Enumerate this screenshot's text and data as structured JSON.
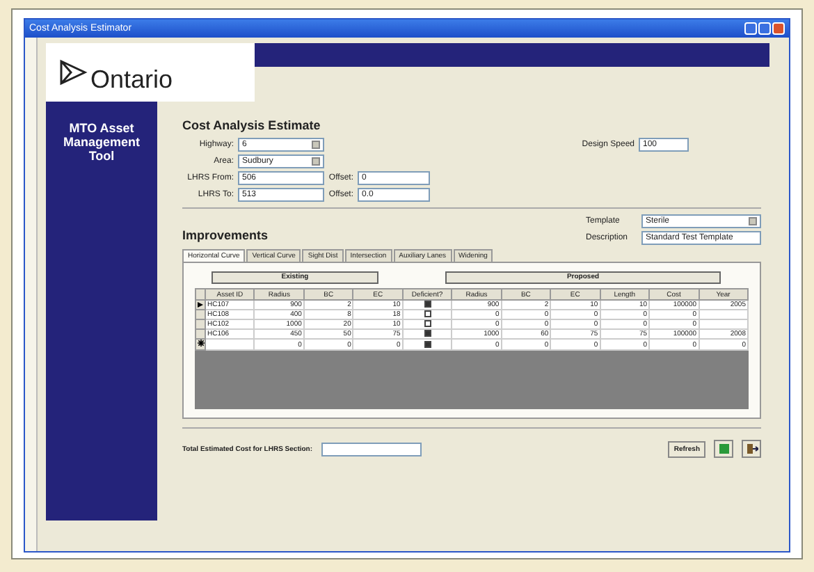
{
  "window": {
    "title": "Cost Analysis Estimator"
  },
  "logo": {
    "text": "Ontario"
  },
  "sidebar": {
    "title": "MTO Asset Management Tool"
  },
  "form": {
    "title": "Cost Analysis Estimate",
    "highway": {
      "label": "Highway:",
      "value": "6"
    },
    "area": {
      "label": "Area:",
      "value": "Sudbury"
    },
    "lhrs_from": {
      "label": "LHRS From:",
      "value": "506"
    },
    "offset_from": {
      "label": "Offset:",
      "value": "0"
    },
    "lhrs_to": {
      "label": "LHRS To:",
      "value": "513"
    },
    "offset_to": {
      "label": "Offset:",
      "value": "0.0"
    },
    "design_speed": {
      "label": "Design Speed",
      "value": "100"
    }
  },
  "template": {
    "label": "Template",
    "value": "Sterile"
  },
  "description": {
    "label": "Description",
    "value": "Standard Test Template"
  },
  "improvements": {
    "title": "Improvements",
    "tabs": [
      {
        "label": "Horizontal Curve",
        "selected": true
      },
      {
        "label": "Vertical Curve",
        "selected": false
      },
      {
        "label": "Sight Dist",
        "selected": false
      },
      {
        "label": "Intersection",
        "selected": false
      },
      {
        "label": "Auxiliary Lanes",
        "selected": false
      },
      {
        "label": "Widening",
        "selected": false
      }
    ],
    "groups": [
      "Existing",
      "Proposed"
    ],
    "columns": [
      "Asset ID",
      "Radius",
      "BC",
      "EC",
      "Deficient?",
      "Radius",
      "BC",
      "EC",
      "Length",
      "Cost",
      "Year"
    ],
    "rows": [
      {
        "kind": "current",
        "cells": [
          "HC107",
          "900",
          "2",
          "10"
        ],
        "deficient": true,
        "proposed": [
          "900",
          "2",
          "10",
          "10",
          "100000",
          "2005"
        ]
      },
      {
        "kind": "plain",
        "cells": [
          "HC108",
          "400",
          "8",
          "18"
        ],
        "deficient": false,
        "proposed": [
          "0",
          "0",
          "0",
          "0",
          "0"
        ]
      },
      {
        "kind": "plain",
        "cells": [
          "HC102",
          "1000",
          "20",
          "10"
        ],
        "deficient": false,
        "proposed": [
          "0",
          "0",
          "0",
          "0",
          "0"
        ]
      },
      {
        "kind": "plain",
        "cells": [
          "HC106",
          "450",
          "50",
          "75"
        ],
        "deficient": true,
        "proposed": [
          "1000",
          "60",
          "75",
          "75",
          "100000",
          "2008"
        ]
      },
      {
        "kind": "new",
        "cells": [
          "",
          "0",
          "0",
          "0"
        ],
        "deficient": true,
        "proposed": [
          "0",
          "0",
          "0",
          "0",
          "0",
          "0"
        ]
      }
    ]
  },
  "footer": {
    "total_label": "Total Estimated Cost for LHRS Section:",
    "button": "Refresh"
  }
}
